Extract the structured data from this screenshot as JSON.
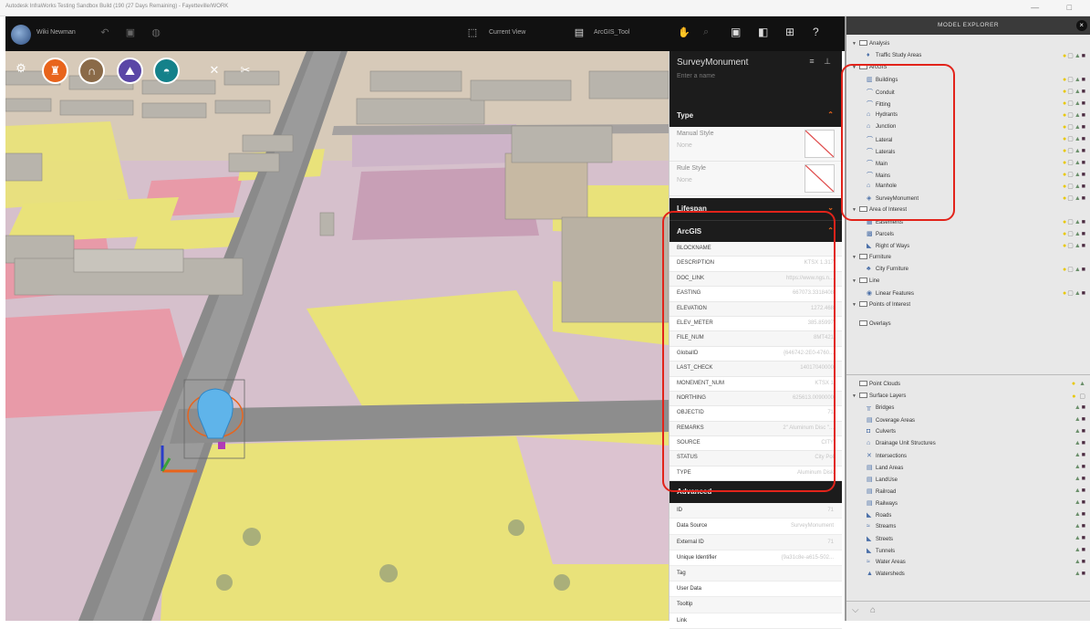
{
  "window": {
    "title": "Autodesk InfraWorks Testing Sandbox Build (190 (27 Days Remaining) - Fayetteville/WORK",
    "controls": "— □"
  },
  "toolbar": {
    "user": "Wiki Newman",
    "current_view": "Current View",
    "arcgis_tool": "ArcGIS_Tool"
  },
  "property_panel": {
    "object_name": "SurveyMonument",
    "name_placeholder": "Enter a name",
    "type_section": "Type",
    "manual_style_label": "Manual Style",
    "manual_style_value": "None",
    "rule_style_label": "Rule Style",
    "rule_style_value": "None",
    "lifespan_section": "Lifespan",
    "arcgis_section": "ArcGIS",
    "arcgis_fields": [
      {
        "key": "BLOCKNAME",
        "value": ""
      },
      {
        "key": "DESCRIPTION",
        "value": "KTSX 1.317"
      },
      {
        "key": "DOC_LINK",
        "value": "https://www.ngs.n..."
      },
      {
        "key": "EASTING",
        "value": "667073.3318408"
      },
      {
        "key": "ELEVATION",
        "value": "1272.468"
      },
      {
        "key": "ELEV_METER",
        "value": "385.85997"
      },
      {
        "key": "FILE_NUM",
        "value": "8MT421"
      },
      {
        "key": "GlobalID",
        "value": "{646742-2E0-4760..."
      },
      {
        "key": "LAST_CHECK",
        "value": "14017040000"
      },
      {
        "key": "MONEMENT_NUM",
        "value": "KTSX 1"
      },
      {
        "key": "NORTHING",
        "value": "625613.0090000"
      },
      {
        "key": "OBJECTID",
        "value": "71"
      },
      {
        "key": "REMARKS",
        "value": "2\" Aluminum Disc \"..."
      },
      {
        "key": "SOURCE",
        "value": "CITY"
      },
      {
        "key": "STATUS",
        "value": "City Pol"
      },
      {
        "key": "TYPE",
        "value": "Aluminum Disk"
      }
    ],
    "advanced_section": "Advanced",
    "advanced_fields": [
      {
        "key": "ID",
        "value": "71"
      },
      {
        "key": "Data Source",
        "value": "SurveyMonument"
      },
      {
        "key": "External ID",
        "value": "71"
      },
      {
        "key": "Unique Identifier",
        "value": "{9a31c8e-a615-502..."
      },
      {
        "key": "Tag",
        "value": ""
      },
      {
        "key": "User Data",
        "value": ""
      },
      {
        "key": "Tooltip",
        "value": ""
      },
      {
        "key": "Link",
        "value": ""
      }
    ]
  },
  "explorer": {
    "title": "MODEL EXPLORER",
    "close": "×",
    "bottom_icons": [
      "⌵",
      "⌂"
    ],
    "rows": [
      {
        "label": "Analysis",
        "kind": "group"
      },
      {
        "label": "Traffic Study Areas",
        "kind": "child",
        "icon": "♦",
        "icons": "💡▢🔒■"
      },
      {
        "label": "ArcGIS",
        "kind": "group"
      },
      {
        "label": "Buildings",
        "kind": "child",
        "icon": "▥",
        "icons": "💡▢🔒■"
      },
      {
        "label": "Conduit",
        "kind": "child",
        "icon": "⌒",
        "icons": "💡▢🔒■"
      },
      {
        "label": "Fitting",
        "kind": "child",
        "icon": "⌒",
        "icons": "💡▢🔒■"
      },
      {
        "label": "Hydrants",
        "kind": "child",
        "icon": "⌂",
        "icons": "💡▢🔒■"
      },
      {
        "label": "Junction",
        "kind": "child",
        "icon": "⌂",
        "icons": "💡▢🔒■"
      },
      {
        "label": "Lateral",
        "kind": "child",
        "icon": "⌒",
        "icons": "💡▢🔒■"
      },
      {
        "label": "Laterals",
        "kind": "child",
        "icon": "⌒",
        "icons": "💡▢🔒■"
      },
      {
        "label": "Main",
        "kind": "child",
        "icon": "⌒",
        "icons": "💡▢🔒■"
      },
      {
        "label": "Mains",
        "kind": "child",
        "icon": "⌒",
        "icons": "💡▢🔒■"
      },
      {
        "label": "Manhole",
        "kind": "child",
        "icon": "⌂",
        "icons": "💡▢🔒■"
      },
      {
        "label": "SurveyMonument",
        "kind": "child",
        "icon": "◈",
        "icons": "💡▢🔒■"
      },
      {
        "label": "Area of Interest",
        "kind": "group"
      },
      {
        "label": "Easements",
        "kind": "child",
        "icon": "▦",
        "icons": "💡▢🔒■"
      },
      {
        "label": "Parcels",
        "kind": "child",
        "icon": "▩",
        "icons": "💡▢🔒■"
      },
      {
        "label": "Right of Ways",
        "kind": "child",
        "icon": "◣",
        "icons": "💡▢🔒■"
      },
      {
        "label": "Furniture",
        "kind": "group"
      },
      {
        "label": "City Furniture",
        "kind": "child",
        "icon": "♣",
        "icons": "💡▢🔒■"
      },
      {
        "label": "Line",
        "kind": "group"
      },
      {
        "label": "Linear Features",
        "kind": "child",
        "icon": "◉",
        "icons": "💡▢🔒■"
      },
      {
        "label": "Points of Interest",
        "kind": "group"
      },
      {
        "label": "Overlays",
        "kind": "plain"
      },
      {
        "label": "Point Clouds",
        "kind": "plain2",
        "icons": "💡 🔒"
      },
      {
        "label": "Surface Layers",
        "kind": "group2",
        "icons": "💡 ▢"
      },
      {
        "label": "Bridges",
        "kind": "child",
        "icon": "╥",
        "icons": "🔒■"
      },
      {
        "label": "Coverage Areas",
        "kind": "child",
        "icon": "▤",
        "icons": "🔒■"
      },
      {
        "label": "Culverts",
        "kind": "child",
        "icon": "◘",
        "icons": "🔒■"
      },
      {
        "label": "Drainage Unit Structures",
        "kind": "child",
        "icon": "⌂",
        "icons": "🔒■"
      },
      {
        "label": "Intersections",
        "kind": "child",
        "icon": "✕",
        "icons": "🔒■"
      },
      {
        "label": "Land Areas",
        "kind": "child",
        "icon": "▤",
        "icons": "🔒■"
      },
      {
        "label": "LandUse",
        "kind": "child",
        "icon": "▤",
        "icons": "🔒■"
      },
      {
        "label": "Railroad",
        "kind": "child",
        "icon": "▤",
        "icons": "🔒■"
      },
      {
        "label": "Railways",
        "kind": "child",
        "icon": "▤",
        "icons": "🔒■"
      },
      {
        "label": "Roads",
        "kind": "child",
        "icon": "◣",
        "icons": "🔒■"
      },
      {
        "label": "Streams",
        "kind": "child",
        "icon": "≈",
        "icons": "🔒■"
      },
      {
        "label": "Streets",
        "kind": "child",
        "icon": "◣",
        "icons": "🔒■"
      },
      {
        "label": "Tunnels",
        "kind": "child",
        "icon": "◣",
        "icons": "🔒■"
      },
      {
        "label": "Water Areas",
        "kind": "child",
        "icon": "≈",
        "icons": "🔒■"
      },
      {
        "label": "Watersheds",
        "kind": "child",
        "icon": "▲",
        "icons": "🔒■"
      }
    ]
  },
  "colors": {
    "accent": "#e8641c",
    "annotation": "#e2231a",
    "panel_dark": "#1c1c1c",
    "landuse_yellow": "#e9e27a",
    "landuse_pink": "#e89aa8",
    "landuse_mauve": "#cdb6c8"
  },
  "icons": {
    "viewport_tools": [
      "settings-icon",
      "traffic-icon",
      "bridge-icon",
      "terrain-icon",
      "dome-icon",
      "wrench-icon",
      "tools-icon"
    ],
    "toolbar": [
      "undo-icon",
      "save-icon",
      "globe-icon",
      "view-icon",
      "layer-icon",
      "explorer-icon",
      "panel-icon",
      "grid-icon",
      "help-icon"
    ]
  }
}
